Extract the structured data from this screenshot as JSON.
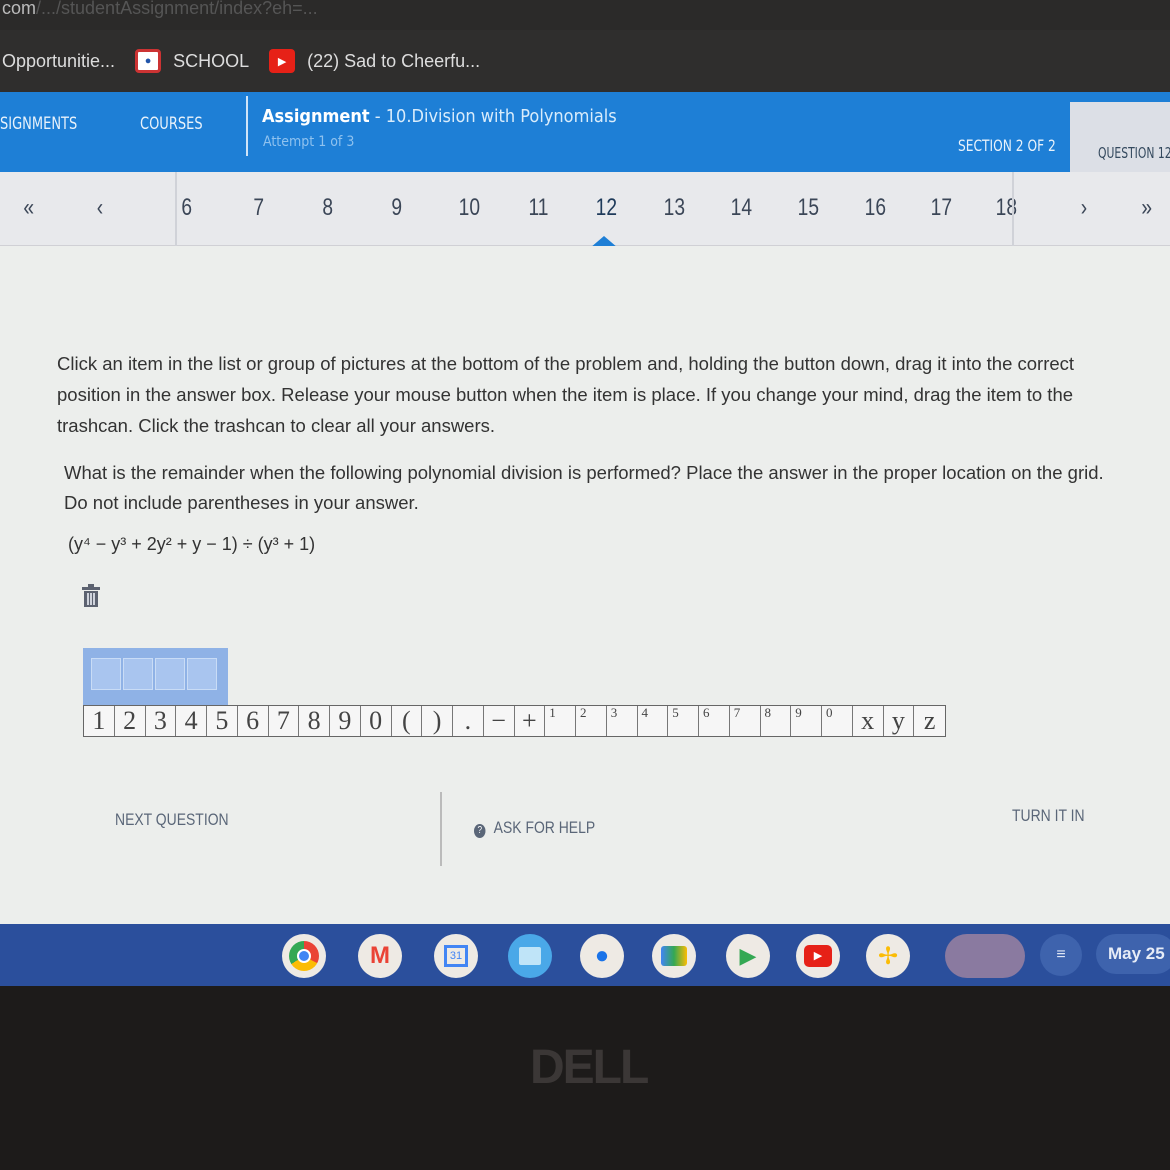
{
  "browser": {
    "url_visible": "com",
    "url_dim": "/.../studentAssignment/index?eh=...",
    "bookmarks": [
      {
        "label": "Opportunitie...",
        "icon": "none"
      },
      {
        "label": "SCHOOL",
        "icon": "school-icon"
      },
      {
        "label": "(22) Sad to Cheerfu...",
        "icon": "youtube-icon"
      }
    ]
  },
  "header": {
    "nav_assignments": "SIGNMENTS",
    "nav_courses": "COURSES",
    "assignment_label": "Assignment",
    "assignment_name": " - 10.Division with Polynomials",
    "attempt": "Attempt 1 of 3",
    "section": "SECTION 2 OF 2",
    "question": "QUESTION 12",
    "accent": "#1e7fd6"
  },
  "pager": {
    "first": "«",
    "prev": "‹",
    "pages": [
      "6",
      "7",
      "8",
      "9",
      "10",
      "11",
      "12",
      "13",
      "14",
      "15",
      "16",
      "17",
      "18"
    ],
    "current": "12",
    "next": "›",
    "last": "»"
  },
  "content": {
    "instructions": "Click an item in the list or group of pictures at the bottom of the problem and, holding the button down, drag it into the correct position in the answer box. Release your mouse button when the item is place. If you change your mind, drag the item to the trashcan. Click the trashcan to clear all your answers.",
    "question": "What is the remainder when the following polynomial division is performed? Place the answer in the proper location on the grid. Do not include parentheses in your answer.",
    "expression_html": "(y⁴ − y³ + 2y² + y − 1) ÷ (y³ + 1)",
    "tiles": [
      "1",
      "2",
      "3",
      "4",
      "5",
      "6",
      "7",
      "8",
      "9",
      "0",
      "(",
      ")",
      ".",
      "−",
      "+"
    ],
    "superscript_tiles": [
      "1",
      "2",
      "3",
      "4",
      "5",
      "6",
      "7",
      "8",
      "9",
      "0"
    ],
    "variable_tiles": [
      "x",
      "y",
      "z"
    ]
  },
  "footer": {
    "next_question": "NEXT QUESTION",
    "ask_for_help": "ASK FOR HELP",
    "turn_it_in": "TURN IT IN"
  },
  "taskbar": {
    "apps": [
      "chrome-icon",
      "gmail-icon",
      "calendar-icon",
      "files-icon",
      "messages-icon",
      "meet-icon",
      "play-store-icon",
      "youtube-icon",
      "photos-icon"
    ],
    "calendar_day": "31",
    "date": "May 25"
  },
  "bezel": {
    "logo": "DELL"
  }
}
